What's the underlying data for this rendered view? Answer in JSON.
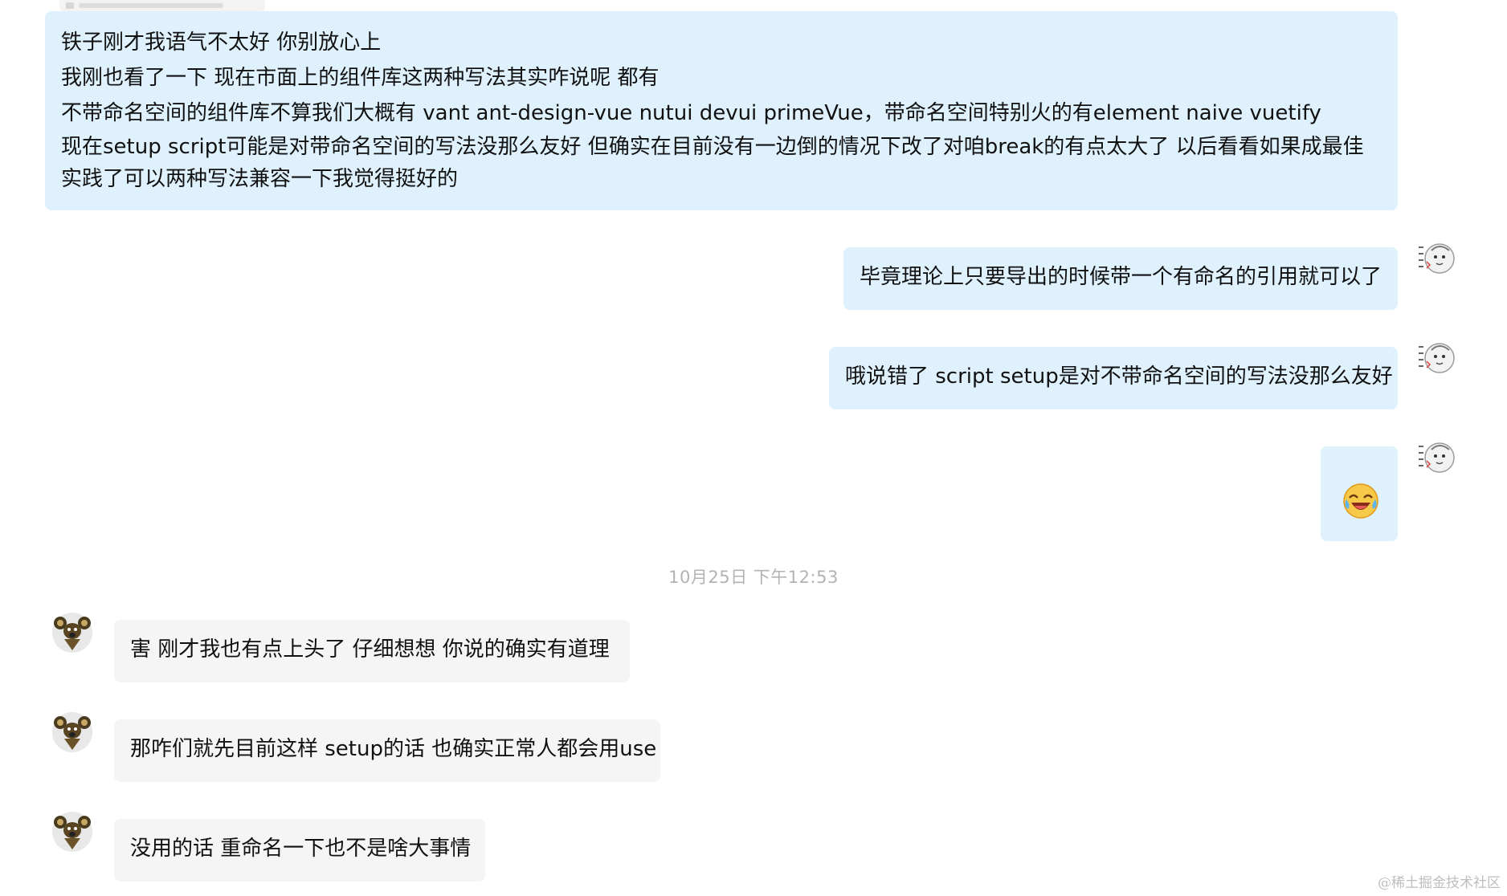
{
  "messages": {
    "top": {
      "lines": [
        "铁子刚才我语气不太好 你别放心上",
        "我刚也看了一下 现在市面上的组件库这两种写法其实咋说呢 都有",
        "不带命名空间的组件库不算我们大概有 vant ant-design-vue nutui devui primeVue，带命名空间特别火的有element naive vuetify",
        "现在setup script可能是对带命名空间的写法没那么友好 但确实在目前没有一边倒的情况下改了对咱break的有点太大了 以后看看如果成最佳实践了可以两种写法兼容一下我觉得挺好的"
      ]
    },
    "right_1": "毕竟理论上只要导出的时候带一个有命名的引用就可以了",
    "right_2": "哦说错了 script setup是对不带命名空间的写法没那么友好",
    "timestamp": "10月25日 下午12:53",
    "left_1": "害 刚才我也有点上头了 仔细想想 你说的确实有道理",
    "left_2": "那咋们就先目前这样 setup的话 也确实正常人都会用use",
    "left_3": "没用的话 重命名一下也不是啥大事情"
  },
  "emoji": "face-with-tears-of-joy-icon",
  "watermark": "@稀土掘金技术社区",
  "colors": {
    "self_bubble": "#def1fd",
    "other_bubble": "#f5f5f5",
    "timestamp_text": "#b3b3b3",
    "watermark_text": "#bdbdbd"
  }
}
